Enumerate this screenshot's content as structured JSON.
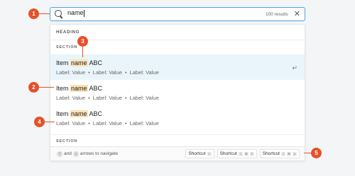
{
  "search": {
    "value": "name",
    "result_count": "100 results"
  },
  "panel": {
    "heading": "HEADING",
    "section_1": "SECTION",
    "section_2": "SECTION",
    "items": [
      {
        "title_prefix": "Item ",
        "title_match": "name",
        "title_suffix": " ABC",
        "meta_1": "Label: Value",
        "meta_2": "Label: Value",
        "meta_3": "Label: Value"
      },
      {
        "title_prefix": "Item ",
        "title_match": "name",
        "title_suffix": " ABC",
        "meta_1": "Label: Value",
        "meta_2": "Label: Value",
        "meta_3": "Label: Value"
      },
      {
        "title_prefix": "Item ",
        "title_match": "name",
        "title_suffix": " ABC",
        "meta_1": "Label: Value",
        "meta_2": "Label: Value",
        "meta_3": "Label: Value"
      }
    ],
    "enter_glyph": "↵",
    "dot": "•"
  },
  "footer": {
    "up_glyph": "↑",
    "and_text": "and",
    "down_glyph": "↓",
    "hint_text": "arrows to navigate",
    "shortcuts": [
      {
        "label": "Shortcut",
        "keys": [
          "↵"
        ]
      },
      {
        "label": "Shortcut",
        "keys": [
          "⇧",
          "⌘",
          "P"
        ]
      },
      {
        "label": "Shortcut",
        "keys": [
          "⇧",
          "⌘",
          "A"
        ]
      }
    ]
  },
  "callouts": [
    "1",
    "2",
    "3",
    "4",
    "5"
  ],
  "colors": {
    "accent": "#e5512b",
    "highlight": "#fbe3b7",
    "active_row": "#e9f5fb",
    "focus_border": "#4aa3df"
  }
}
